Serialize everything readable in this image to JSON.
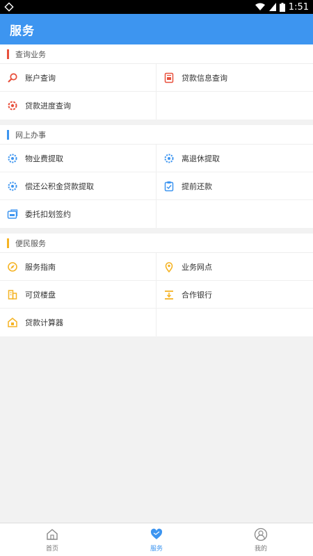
{
  "status": {
    "time": "1:51"
  },
  "header": {
    "title": "服务"
  },
  "sections": [
    {
      "title": "查询业务",
      "accent": "#e8503c",
      "items": [
        {
          "label": "账户查询",
          "icon": "search-icon"
        },
        {
          "label": "贷款信息查询",
          "icon": "document-icon"
        },
        {
          "label": "贷款进度查询",
          "icon": "progress-icon"
        }
      ]
    },
    {
      "title": "网上办事",
      "accent": "#3d95f0",
      "items": [
        {
          "label": "物业费提取",
          "icon": "gear-icon"
        },
        {
          "label": "离退休提取",
          "icon": "gear-icon"
        },
        {
          "label": "偿还公积金贷款提取",
          "icon": "gear-icon"
        },
        {
          "label": "提前还款",
          "icon": "checklist-icon"
        },
        {
          "label": "委托扣划签约",
          "icon": "contract-icon"
        }
      ]
    },
    {
      "title": "便民服务",
      "accent": "#f5b323",
      "items": [
        {
          "label": "服务指南",
          "icon": "compass-icon"
        },
        {
          "label": "业务网点",
          "icon": "location-pin-icon"
        },
        {
          "label": "可贷楼盘",
          "icon": "building-icon"
        },
        {
          "label": "合作银行",
          "icon": "bank-icon"
        },
        {
          "label": "贷款计算器",
          "icon": "calculator-icon"
        }
      ]
    }
  ],
  "tabs": [
    {
      "label": "首页",
      "icon": "home-icon",
      "active": false
    },
    {
      "label": "服务",
      "icon": "heart-icon",
      "active": true
    },
    {
      "label": "我的",
      "icon": "user-icon",
      "active": false
    }
  ],
  "colors": {
    "primary": "#3d95f0",
    "red": "#e8503c",
    "orange": "#f5b323"
  }
}
